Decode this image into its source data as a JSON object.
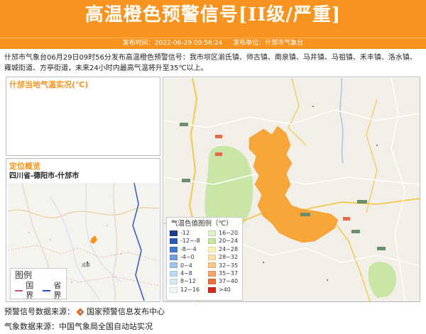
{
  "header": {
    "title": "高温橙色预警信号[II级/严重]",
    "publish_time_label": "发布时间：2022-06-29 09:56:24",
    "publish_unit_label": "发布单位：什邡市气象台"
  },
  "alert_text": "什邡市气象台06月29日09时56分发布高温橙色预警信号：我市坝区湔氐镇、师古镇、南泉镇、马井镇、马祖镇、禾丰镇、洛水镇、雍城街道、方亭街道，未来24小时内最高气温将升至35℃以上。",
  "temp_panel": {
    "title": "什邡当地气温实况(℃)"
  },
  "location_panel": {
    "title": "定位概览",
    "region": "四川省-德阳市-什邡市",
    "map_legend": {
      "title": "图例",
      "items": [
        {
          "label": "国界",
          "color": "#c7506f"
        },
        {
          "label": "省界",
          "color": "#1f4fd6"
        }
      ]
    }
  },
  "temp_scale": {
    "title": "气温色值图例（℃）",
    "left_items": [
      {
        "label": "-12",
        "color": "#1c3d8f"
      },
      {
        "label": "-12~-8",
        "color": "#2b5ab5"
      },
      {
        "label": "-8~-4",
        "color": "#3f7ad0"
      },
      {
        "label": "-4~0",
        "color": "#6f9fe0"
      },
      {
        "label": "0~4",
        "color": "#9ec3ee"
      },
      {
        "label": "4~8",
        "color": "#b9dcf4"
      },
      {
        "label": "8~12",
        "color": "#d7ecf9"
      },
      {
        "label": "12~16",
        "color": "#eef8fc"
      }
    ],
    "right_items": [
      {
        "label": "16~20",
        "color": "#ddf1c8"
      },
      {
        "label": "20~24",
        "color": "#c5e89a"
      },
      {
        "label": "24~28",
        "color": "#fbf5b3"
      },
      {
        "label": "28~32",
        "color": "#fde1a7"
      },
      {
        "label": "32~35",
        "color": "#fdc78a"
      },
      {
        "label": "35~37",
        "color": "#f9a368"
      },
      {
        "label": "37~40",
        "color": "#f26b3a"
      },
      {
        "label": ">40",
        "color": "#d9261c"
      }
    ]
  },
  "footer": {
    "warning_source": "预警信号数据来源：",
    "warning_source_name": "国家预警信息发布中心",
    "weather_source": "气象数据来源：中国气象局全国自动站实况"
  },
  "colors": {
    "brand_orange": "#f7931e",
    "warning_area": "#f7a63a",
    "green_area": "#c9e6a7"
  }
}
